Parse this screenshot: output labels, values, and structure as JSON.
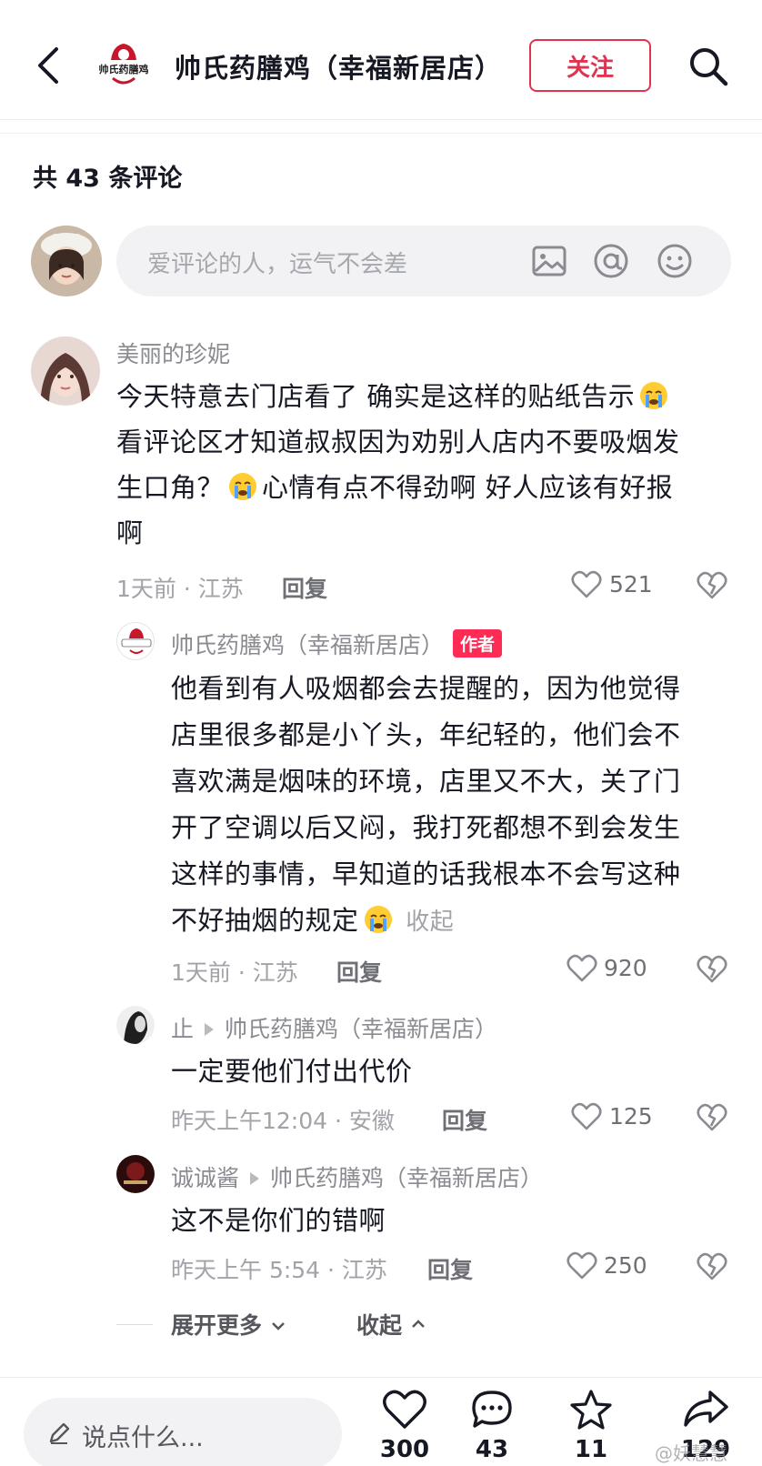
{
  "header": {
    "shop_name": "帅氏药膳鸡（幸福新居店）",
    "logo_text": "帅氏药膳鸡",
    "follow_label": "关注"
  },
  "comment_count_label": "共 43 条评论",
  "compose": {
    "placeholder": "爱评论的人，运气不会差"
  },
  "comments": [
    {
      "user": "美丽的珍妮",
      "text_lines": [
        "今天特意去门店看了 确实是这样的贴纸告示",
        "看评论区才知道叔叔因为劝别人店内不要吸烟发",
        "生口角？",
        "心情有点不得劲啊 好人应该有好报",
        "啊"
      ],
      "meta": "1天前 · 江苏",
      "reply_label": "回复",
      "likes": "521"
    }
  ],
  "replies": [
    {
      "user": "帅氏药膳鸡（幸福新居店）",
      "badge": "作者",
      "text_lines": [
        "他看到有人吸烟都会去提醒的，因为他觉得",
        "店里很多都是小丫头，年纪轻的，他们会不",
        "喜欢满是烟味的环境，店里又不大，关了门",
        "开了空调以后又闷，我打死都想不到会发生",
        "这样的事情，早知道的话我根本不会写这种",
        "不好抽烟的规定"
      ],
      "collapse_label": "收起",
      "meta": "1天前 · 江苏",
      "reply_label": "回复",
      "likes": "920"
    },
    {
      "user": "止",
      "reply_to": "帅氏药膳鸡（幸福新居店）",
      "text": "一定要他们付出代价",
      "meta": "昨天上午12:04 · 安徽",
      "reply_label": "回复",
      "likes": "125"
    },
    {
      "user": "诚诚酱",
      "reply_to": "帅氏药膳鸡（幸福新居店）",
      "text": "这不是你们的错啊",
      "meta": "昨天上午 5:54 · 江苏",
      "reply_label": "回复",
      "likes": "250"
    }
  ],
  "expand_more_label": "展开更多",
  "collapse_all_label": "收起",
  "bottom_bar": {
    "input_placeholder": "说点什么...",
    "likes": "300",
    "comments": "43",
    "favorites": "11",
    "shares": "129"
  },
  "watermark": "@妖慧慧",
  "colors": {
    "accent": "#fe2c55",
    "follow_border": "#e0334f",
    "muted_text": "#a2a3a8"
  },
  "icons": [
    "back-icon",
    "search-icon",
    "image-icon",
    "at-icon",
    "emoji-icon",
    "heart-icon",
    "dislike-icon",
    "comment-icon",
    "star-icon",
    "share-icon",
    "pencil-icon",
    "crying-emoji-icon"
  ]
}
